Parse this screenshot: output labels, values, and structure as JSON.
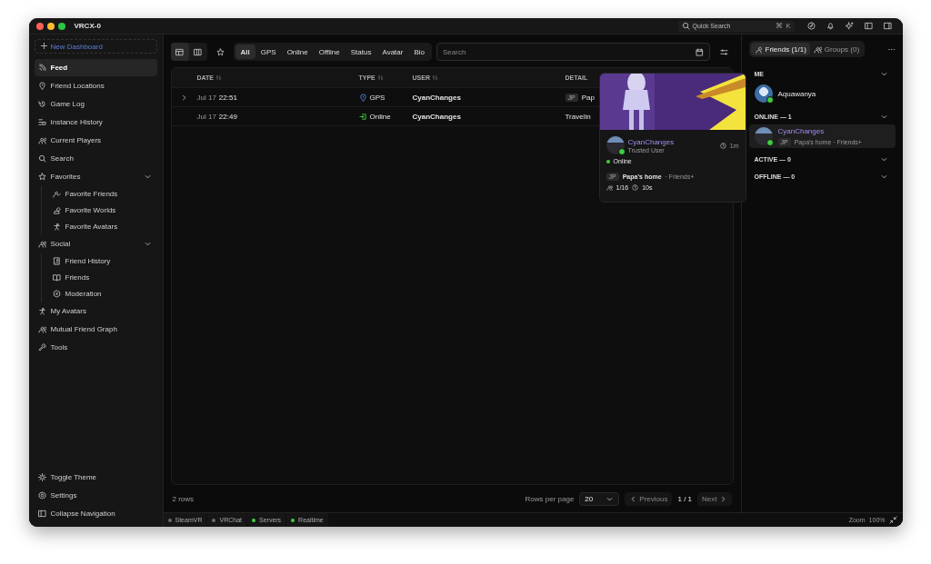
{
  "window": {
    "title": "VRCX-0"
  },
  "quick_search": {
    "placeholder": "Quick Search",
    "shortcut": [
      "⌘",
      "K"
    ]
  },
  "sidebar": {
    "new_dashboard": "New Dashboard",
    "items": [
      {
        "label": "Feed",
        "selected": true
      },
      {
        "label": "Friend Locations",
        "selected": false
      },
      {
        "label": "Game Log",
        "selected": false
      },
      {
        "label": "Instance History",
        "selected": false
      },
      {
        "label": "Current Players",
        "selected": false
      },
      {
        "label": "Search",
        "selected": false
      },
      {
        "label": "Favorites",
        "selected": false,
        "expanded": true,
        "children": [
          {
            "label": "Favorite Friends",
            "selected": false
          },
          {
            "label": "Favorite Worlds",
            "selected": false
          },
          {
            "label": "Favorite Avatars",
            "selected": false
          }
        ]
      },
      {
        "label": "Social",
        "selected": false,
        "expanded": true,
        "children": [
          {
            "label": "Friend History",
            "selected": false
          },
          {
            "label": "Friends",
            "selected": false
          },
          {
            "label": "Moderation",
            "selected": false
          }
        ]
      },
      {
        "label": "My Avatars",
        "selected": false
      },
      {
        "label": "Mutual Friend Graph",
        "selected": false
      },
      {
        "label": "Tools",
        "selected": false
      }
    ],
    "bottom": [
      "Toggle Theme",
      "Settings",
      "Collapse Navigation"
    ]
  },
  "toolbar": {
    "views": [
      {
        "selected": true
      },
      {
        "selected": false
      }
    ],
    "filters": [
      {
        "label": "All",
        "selected": true
      },
      {
        "label": "GPS",
        "selected": false
      },
      {
        "label": "Online",
        "selected": false
      },
      {
        "label": "Offline",
        "selected": false
      },
      {
        "label": "Status",
        "selected": false
      },
      {
        "label": "Avatar",
        "selected": false
      },
      {
        "label": "Bio",
        "selected": false
      }
    ],
    "search": {
      "placeholder": "Search"
    }
  },
  "table": {
    "columns": [
      "DATE",
      "TYPE",
      "USER",
      "DETAIL"
    ],
    "rows": [
      {
        "expandable": true,
        "date": "Jul 17",
        "time": "22:51",
        "type": "GPS",
        "kind": "gps",
        "user": "CyanChanges",
        "badge": "JP",
        "detail": "Pap"
      },
      {
        "expandable": false,
        "date": "Jul 17",
        "time": "22:49",
        "type": "Online",
        "kind": "online",
        "user": "CyanChanges",
        "detail": "Travelin"
      }
    ]
  },
  "footer": {
    "count": "2 rows",
    "rows_per_page_label": "Rows per page",
    "rows_per_page": "20",
    "previous": "Previous",
    "page": "1 / 1",
    "next": "Next"
  },
  "popover": {
    "name": "CyanChanges",
    "rank": "Trusted User",
    "ago": "1m",
    "status": "Online",
    "badge": "JP",
    "world": "Papa's home",
    "access": "· Friends+",
    "users": "1/16",
    "duration": "10s"
  },
  "friends_panel": {
    "tabs": [
      {
        "label": "Friends (1/1)",
        "selected": true
      },
      {
        "label": "Groups (0)",
        "selected": false
      }
    ],
    "sections": [
      {
        "title": "ME",
        "expanded": true,
        "friends": [
          {
            "name": "Aquawanya",
            "online": true,
            "highlighted": false
          }
        ]
      },
      {
        "title": "ONLINE — 1",
        "expanded": true,
        "friends": [
          {
            "name": "CyanChanges",
            "online": true,
            "highlighted": true,
            "badge": "JP",
            "location": "Papa's home · Friends+"
          }
        ]
      },
      {
        "title": "ACTIVE — 0",
        "expanded": true
      },
      {
        "title": "OFFLINE — 0",
        "expanded": true
      }
    ]
  },
  "status_bar": {
    "items": [
      {
        "label": "SteamVR",
        "color": "#6b6b6b"
      },
      {
        "label": "VRChat",
        "color": "#6b6b6b"
      },
      {
        "label": "Servers",
        "color": "#3fcf3f"
      },
      {
        "label": "Realtime",
        "color": "#3fcf3f"
      }
    ],
    "zoom_label": "Zoom",
    "zoom": "100%"
  }
}
